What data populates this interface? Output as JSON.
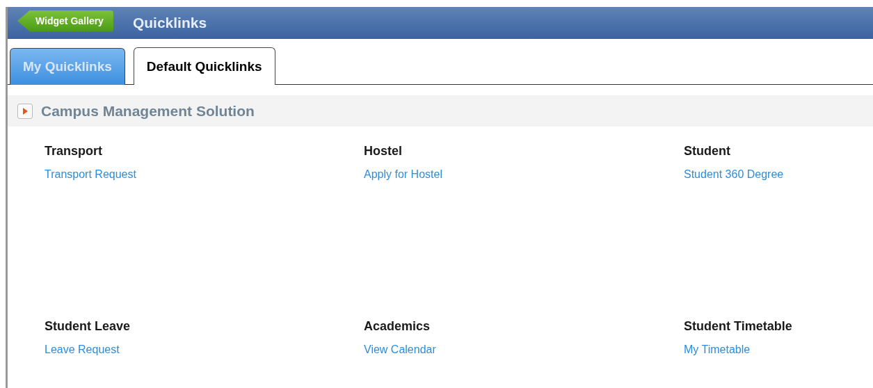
{
  "header": {
    "back_button": "Widget Gallery",
    "title": "Quicklinks"
  },
  "tabs": [
    {
      "label": "My Quicklinks",
      "selected": false
    },
    {
      "label": "Default Quicklinks",
      "selected": true
    }
  ],
  "section": {
    "title": "Campus Management Solution"
  },
  "groups": [
    {
      "title": "Transport",
      "links": [
        "Transport Request"
      ]
    },
    {
      "title": "Hostel",
      "links": [
        "Apply for Hostel"
      ]
    },
    {
      "title": "Student",
      "links": [
        "Student 360 Degree"
      ]
    },
    {
      "title": "Student Leave",
      "links": [
        "Leave Request"
      ]
    },
    {
      "title": "Academics",
      "links": [
        "View Calendar"
      ]
    },
    {
      "title": "Student Timetable",
      "links": [
        "My Timetable"
      ]
    }
  ]
}
